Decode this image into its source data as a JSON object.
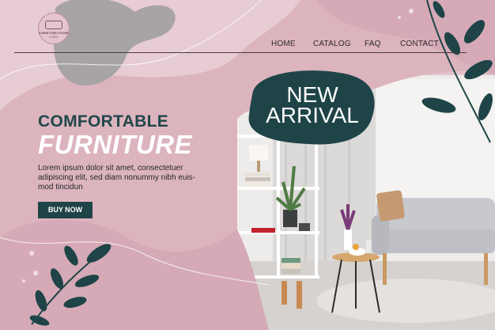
{
  "brand": {
    "logo_line1": "FURNITURE STORE",
    "logo_line2": "LOGO"
  },
  "nav": {
    "items": [
      {
        "label": "HOME"
      },
      {
        "label": "CATALOG"
      },
      {
        "label": "FAQ"
      },
      {
        "label": "CONTACT"
      }
    ]
  },
  "hero": {
    "title_line1": "COMFORTABLE",
    "title_line2": "FURNITURE",
    "body": "Lorem ipsum dolor sit amet, consectetuer adipiscing elit, sed diam nonummy nibh euis- mod tincidun",
    "cta_label": "BUY NOW"
  },
  "badge": {
    "line1": "NEW",
    "line2": "ARRIVAL"
  },
  "colors": {
    "pink_bg": "#e3c3cc",
    "dark_pink": "#d5aab6",
    "teal_dark": "#1f4448",
    "grey_blob": "#a8a4a6",
    "white": "#ffffff"
  }
}
